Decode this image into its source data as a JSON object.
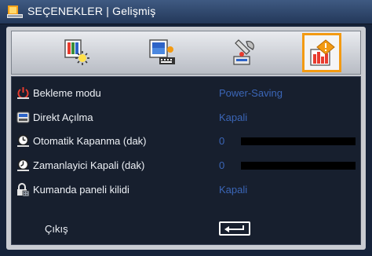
{
  "window": {
    "title": "SEÇENEKLER | Gelişmiş",
    "icon": "projector-menu-icon"
  },
  "tabs": [
    {
      "name": "image-settings-icon",
      "selected": false
    },
    {
      "name": "display-settings-icon",
      "selected": false
    },
    {
      "name": "setup-tools-icon",
      "selected": false
    },
    {
      "name": "options-info-icon",
      "selected": true
    }
  ],
  "menu": {
    "items": [
      {
        "label": "Bekleme modu",
        "value": "Power-Saving",
        "icon": "power-icon"
      },
      {
        "label": "Direkt Açılma",
        "value": "Kapali",
        "icon": "power-on-icon"
      },
      {
        "label": "Otomatik Kapanma (dak)",
        "value": "0",
        "icon": "timer-icon",
        "level": 0
      },
      {
        "label": "Zamanlayici Kapali (dak)",
        "value": "0",
        "icon": "sleep-timer-icon",
        "level": 0
      },
      {
        "label": "Kumanda paneli kilidi",
        "value": "Kapali",
        "icon": "keypad-lock-icon"
      }
    ],
    "exit_label": "Çıkış",
    "exit_icon": "enter-key-icon"
  },
  "colors": {
    "accent": "#f39a12",
    "value_text": "#3b66b7",
    "panel_bg": "#171f2e"
  }
}
